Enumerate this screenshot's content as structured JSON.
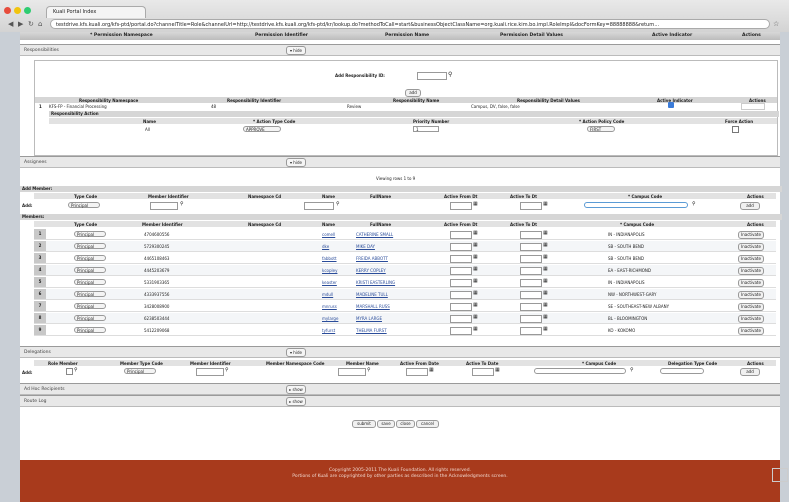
{
  "browser": {
    "tab_title": "Kuali Portal Index",
    "url": "testdrive.kfs.kuali.org/kfs-ptd/portal.do?channelTitle=Role&channelUrl=http://testdrive.kfs.kuali.org/kfs-ptd/kr/lookup.do?methodToCall=start&businessObjectClassName=org.kuali.rice.kim.bo.impl.RoleImpl&docFormKey=88888888&return..."
  },
  "top_header": [
    "* Permission Namespace",
    "Permission Identifier",
    "Permission Name",
    "Permission Detail Values",
    "Active Indicator",
    "Actions"
  ],
  "responsibilities": {
    "section_title": "Responsibilities",
    "toggle": "▾ hide",
    "add_label": "Add Responsibility ID:",
    "add_btn": "add",
    "headers": [
      "Responsibility Namespace",
      "Responsibility Identifier",
      "Responsibility Name",
      "Responsibility Detail Values",
      "Active Indicator",
      "Actions"
    ],
    "row": {
      "index": "1",
      "namespace": "KFS-FP - Financial Processing",
      "identifier": "48",
      "name": "Review",
      "details": "Campus, DV, false, false"
    },
    "action_title": "Responsibility Action",
    "action_headers": [
      "Name",
      "* Action Type Code",
      "Priority Number",
      "* Action Policy Code",
      "Force Action"
    ],
    "action_row": {
      "name": "All",
      "type": "APPROVE",
      "priority": "1",
      "policy": "FIRST"
    }
  },
  "assignees": {
    "section_title": "Assignees",
    "toggle": "▾ hide",
    "viewing": "Viewing rows 1 to 9",
    "add_member": "Add Member:",
    "add": "Add:",
    "add_headers": [
      "Type Code",
      "Member Identifier",
      "Namespace Cd",
      "Name",
      "FullName",
      "Active From Dt",
      "Active To Dt",
      "* Campus Code",
      "Actions"
    ],
    "add_type": "Principal",
    "add_btn": "add",
    "members_label": "Members:",
    "member_headers": [
      "Type Code",
      "Member Identifier",
      "Namespace Cd",
      "Name",
      "FullName",
      "Active From Dt",
      "Active To Dt",
      "* Campus Code",
      "Actions"
    ],
    "members": [
      {
        "i": "1",
        "type": "Principal",
        "id": "4704600556",
        "name": "comell",
        "full": "CATHERINE SMALL",
        "campus": "IN - INDIANAPOLIS",
        "act": "Inactivate"
      },
      {
        "i": "2",
        "type": "Principal",
        "id": "5729300245",
        "name": "dke",
        "full": "MIKE DAY",
        "campus": "SB - SOUTH BEND",
        "act": "Inactivate"
      },
      {
        "i": "3",
        "type": "Principal",
        "id": "4465108463",
        "name": "fabbott",
        "full": "FREIDA ABBOTT",
        "campus": "SB - SOUTH BEND",
        "act": "Inactivate"
      },
      {
        "i": "4",
        "type": "Principal",
        "id": "4445203679",
        "name": "kcopley",
        "full": "KERRY COPLEY",
        "campus": "EA - EAST-RICHMOND",
        "act": "Inactivate"
      },
      {
        "i": "5",
        "type": "Principal",
        "id": "5331903365",
        "name": "keaster",
        "full": "KRISTI EASTERLING",
        "campus": "IN - INDIANAPOLIS",
        "act": "Inactivate"
      },
      {
        "i": "6",
        "type": "Principal",
        "id": "4333937556",
        "name": "mdull",
        "full": "MADELINE TULL",
        "campus": "NW - NORTHWEST-GARY",
        "act": "Inactivate"
      },
      {
        "i": "7",
        "type": "Principal",
        "id": "3428008900",
        "name": "mnruss",
        "full": "MARSHALL RUSS",
        "campus": "SE - SOUTHEAST-NEW ALBANY",
        "act": "Inactivate"
      },
      {
        "i": "8",
        "type": "Principal",
        "id": "6238503444",
        "name": "mylarge",
        "full": "MYRA LARGE",
        "campus": "BL - BLOOMINGTON",
        "act": "Inactivate"
      },
      {
        "i": "9",
        "type": "Principal",
        "id": "5412209068",
        "name": "tyfurst",
        "full": "THELMA FURST",
        "campus": "KO - KOKOMO",
        "act": "Inactivate"
      }
    ]
  },
  "delegations": {
    "section_title": "Delegations",
    "toggle": "▾ hide",
    "add": "Add:",
    "headers": [
      "Role Member",
      "Member Type Code",
      "Member Identifier",
      "Member Namespace Code",
      "Member Name",
      "Active From Date",
      "Active To Date",
      "* Campus Code",
      "Delegation Type Code",
      "Actions"
    ],
    "type": "Principal",
    "add_btn": "add"
  },
  "ad_hoc": {
    "section_title": "Ad Hoc Recipients",
    "toggle": "▸ show"
  },
  "route_log": {
    "section_title": "Route Log",
    "toggle": "▸ show"
  },
  "actions": [
    "submit",
    "save",
    "close",
    "cancel"
  ],
  "footer": {
    "line1": "Copyright 2005-2011 The Kuali Foundation. All rights reserved.",
    "line2": "Portions of Kuali are copyrighted by other parties as described in the Acknowledgments screen."
  }
}
